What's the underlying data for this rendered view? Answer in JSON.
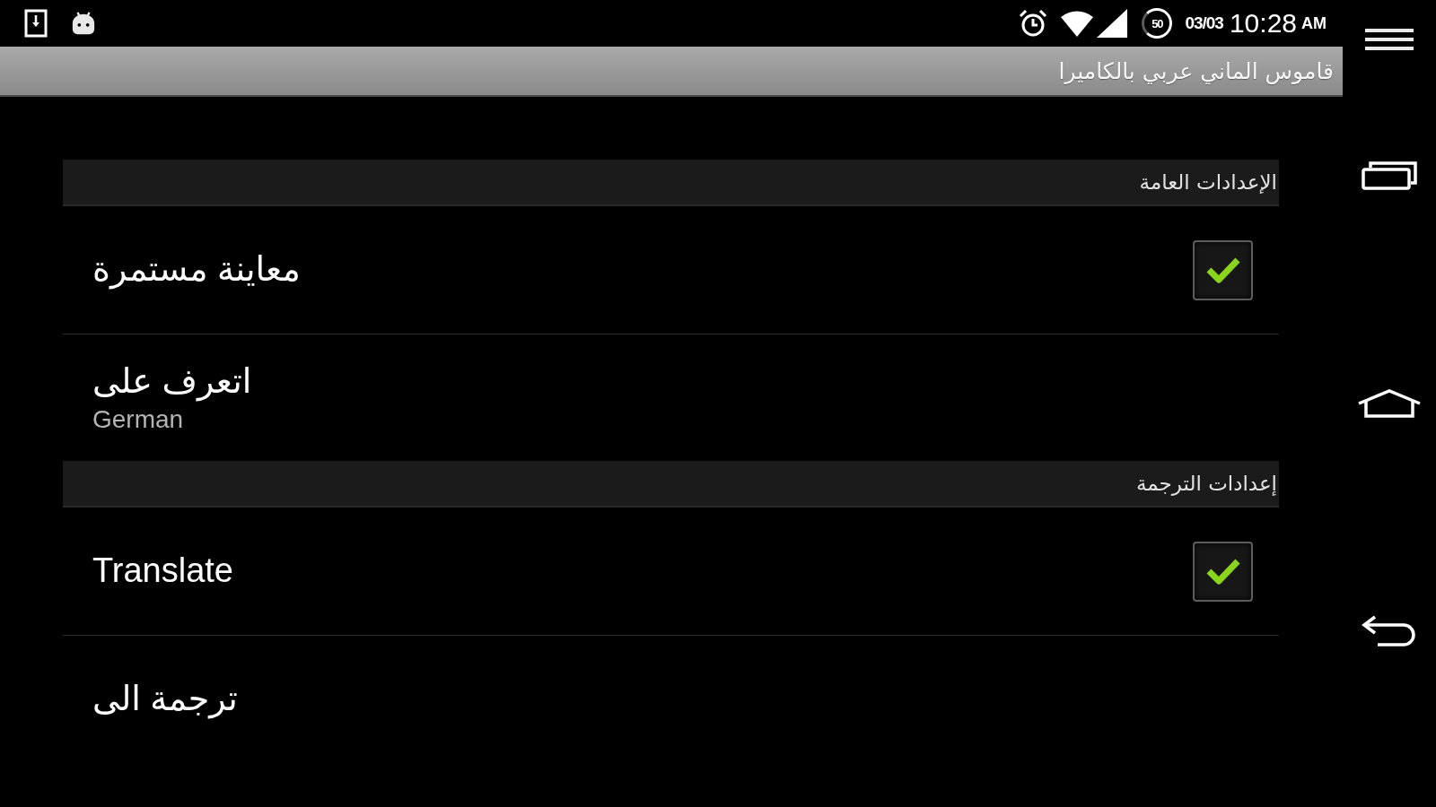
{
  "status_bar": {
    "circle_indicator": "50",
    "date": "03/03",
    "time": "10:28",
    "meridiem": "AM"
  },
  "action_bar": {
    "title": "قاموس الماني عربي بالكاميرا"
  },
  "sections": [
    {
      "title": "الإعدادات العامة",
      "items": [
        {
          "kind": "checkbox",
          "title": "معاينة مستمرة",
          "checked": true
        },
        {
          "kind": "list",
          "title": "اتعرف على",
          "summary": "German"
        }
      ]
    },
    {
      "title": "إعدادات الترجمة",
      "items": [
        {
          "kind": "checkbox",
          "title": "Translate",
          "checked": true
        },
        {
          "kind": "list",
          "title": "ترجمة الى"
        }
      ]
    }
  ]
}
